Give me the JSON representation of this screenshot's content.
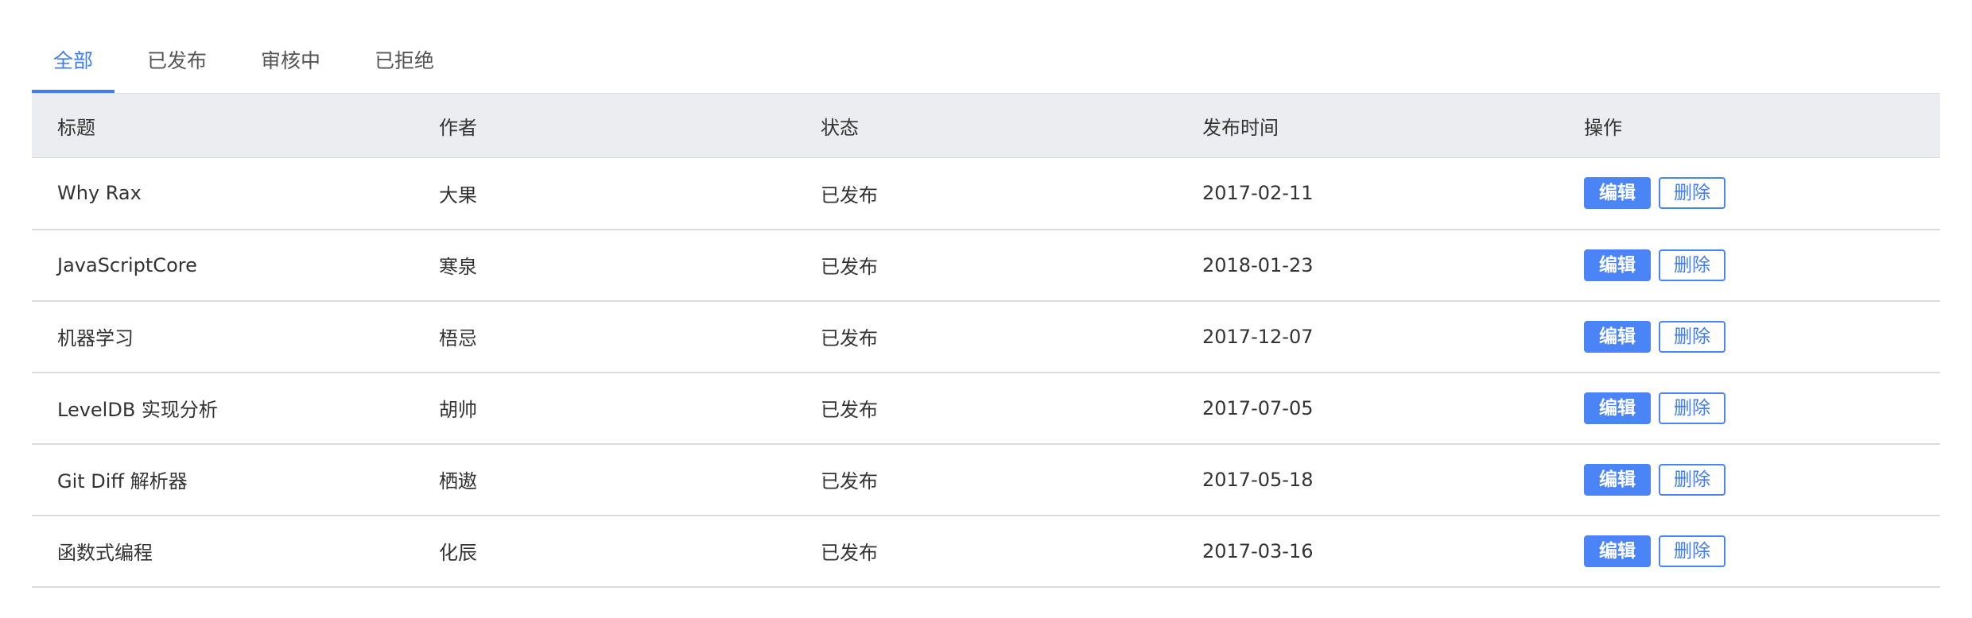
{
  "tabs": [
    {
      "label": "全部",
      "active": true
    },
    {
      "label": "已发布",
      "active": false
    },
    {
      "label": "审核中",
      "active": false
    },
    {
      "label": "已拒绝",
      "active": false
    }
  ],
  "table": {
    "headers": [
      "标题",
      "作者",
      "状态",
      "发布时间",
      "操作"
    ],
    "edit_label": "编辑",
    "delete_label": "删除",
    "rows": [
      {
        "title": "Why Rax",
        "author": "大果",
        "status": "已发布",
        "date": "2017-02-11"
      },
      {
        "title": "JavaScriptCore",
        "author": "寒泉",
        "status": "已发布",
        "date": "2018-01-23"
      },
      {
        "title": "机器学习",
        "author": "梧忌",
        "status": "已发布",
        "date": "2017-12-07"
      },
      {
        "title": "LevelDB 实现分析",
        "author": "胡帅",
        "status": "已发布",
        "date": "2017-07-05"
      },
      {
        "title": "Git Diff 解析器",
        "author": "栖遨",
        "status": "已发布",
        "date": "2017-05-18"
      },
      {
        "title": "函数式编程",
        "author": "化辰",
        "status": "已发布",
        "date": "2017-03-16"
      }
    ]
  },
  "colors": {
    "accent": "#3f7cf6",
    "header_bg": "#ebedf1"
  }
}
